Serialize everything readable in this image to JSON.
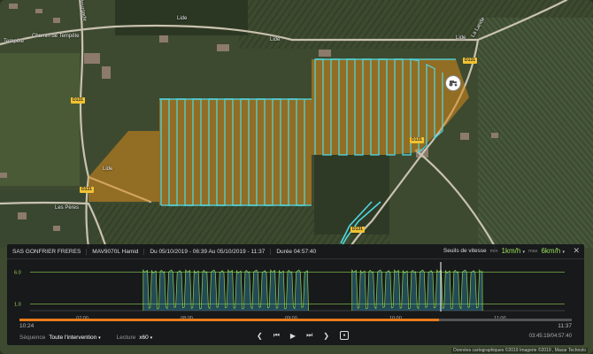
{
  "map": {
    "road_labels": [
      "Tempête",
      "Chemin de Tempête",
      "Lide",
      "Lide",
      "Lide",
      "La Lande",
      "Lide",
      "Les Pères",
      "Bourgade"
    ],
    "route_badges": [
      "D131",
      "D131",
      "D131",
      "D131",
      "D131"
    ],
    "poi_icon": "tractor-icon",
    "credits": "Données cartographiques ©2019 Imagerie ©2019 , Maxar Technolo",
    "colors": {
      "track": "#4fd6e0",
      "fill": "#d98a1c"
    }
  },
  "panel": {
    "company": "SAS GONFRIER FRERES",
    "vehicle": "MAV9070L Hamid",
    "period": "Du 05/10/2019 - 06:39 Au 05/10/2019 - 11:37",
    "duration": "Durée 04:57:40",
    "thresholds_label": "Seuils de vitesse",
    "min_label": "min",
    "min_value": "1km/h",
    "max_label": "max",
    "max_value": "6km/h",
    "close_icon": "close-icon"
  },
  "chart_data": {
    "type": "line",
    "title": "",
    "xlabel": "",
    "ylabel": "",
    "y_ticks": [
      "6.0",
      "1.0"
    ],
    "x_ticks": [
      "07:00",
      "08:00",
      "09:00",
      "10:00",
      "11:00"
    ],
    "thresholds": [
      6.0,
      1.0
    ],
    "work_periods": [
      [
        "07:35",
        "09:10"
      ],
      [
        "09:35",
        "10:50"
      ]
    ],
    "colors": {
      "series": "#8fd14f",
      "fill": "#3aa7c9",
      "threshold": "#8fd14f"
    }
  },
  "timeline": {
    "start": "10:24",
    "end": "11:37",
    "progress": 0.76
  },
  "controls": {
    "sequence_label": "Séquence",
    "sequence_value": "Toute l'intervention",
    "playback_label": "Lecture",
    "playback_value": "x60",
    "clock": "03:45:19/04:57:40",
    "icons": [
      "prev-icon",
      "skip-start-icon",
      "play-icon",
      "skip-end-icon",
      "next-icon",
      "screenshot-icon"
    ]
  }
}
